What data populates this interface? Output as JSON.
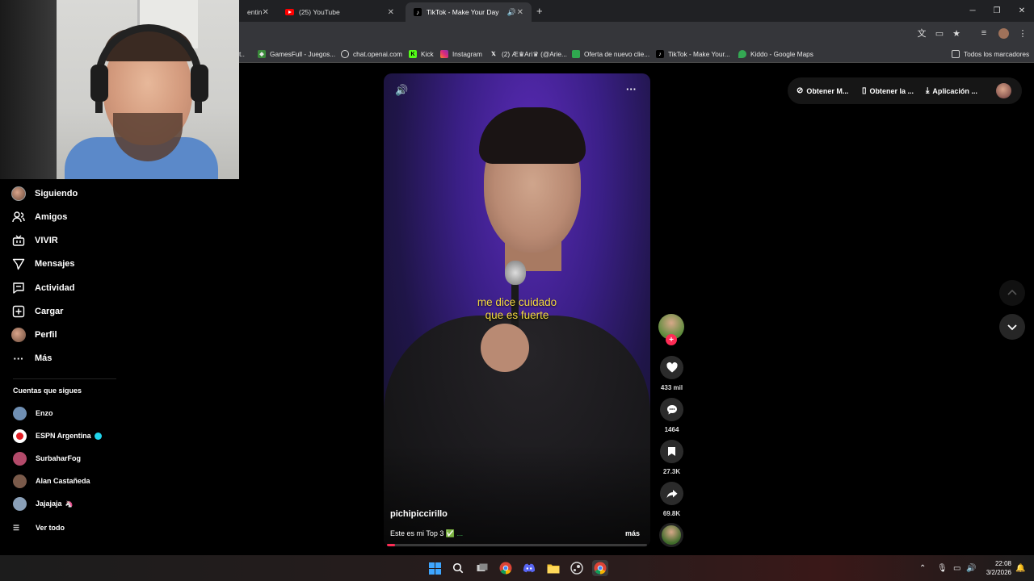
{
  "browser": {
    "tabs": [
      {
        "label": "entin",
        "active": false
      },
      {
        "label": "(25) YouTube",
        "active": false
      },
      {
        "label": "TikTok - Make Your Day",
        "active": true
      }
    ],
    "new_tab": "+",
    "window_controls": {
      "minimize": "─",
      "restore": "❐",
      "close": "✕"
    }
  },
  "bookmarks": {
    "items": [
      {
        "label": "GamesFull - Juegos...",
        "icon": "gamepad-icon"
      },
      {
        "label": "chat.openai.com",
        "icon": "openai-icon"
      },
      {
        "label": "Kick",
        "icon": "kick-icon"
      },
      {
        "label": "Instagram",
        "icon": "instagram-icon"
      },
      {
        "label": "(2) Æ♛Ari♛ (@Arie...",
        "icon": "x-icon"
      },
      {
        "label": "Oferta de nuevo clie...",
        "icon": "store-icon"
      },
      {
        "label": "TikTok - Make Your...",
        "icon": "tiktok-icon"
      },
      {
        "label": "Kiddo - Google Maps",
        "icon": "maps-icon"
      }
    ],
    "all_bookmarks": "Todos los marcadores"
  },
  "sidebar": {
    "items": [
      {
        "label": "Siguiendo",
        "icon": "following-avatar-icon"
      },
      {
        "label": "Amigos",
        "icon": "friends-icon"
      },
      {
        "label": "VIVIR",
        "icon": "live-icon"
      },
      {
        "label": "Mensajes",
        "icon": "messages-icon"
      },
      {
        "label": "Actividad",
        "icon": "activity-icon"
      },
      {
        "label": "Cargar",
        "icon": "upload-icon"
      },
      {
        "label": "Perfil",
        "icon": "profile-avatar-icon"
      },
      {
        "label": "Más",
        "icon": "more-icon"
      }
    ],
    "following_header": "Cuentas que sigues",
    "following": [
      {
        "name": "Enzo",
        "color": "#6f8fb3"
      },
      {
        "name": "ESPN Argentina",
        "color": "#ffffff",
        "verified": true
      },
      {
        "name": "SurbaharFog",
        "color": "#b34a6a"
      },
      {
        "name": "Alan Castañeda",
        "color": "#7a5a4a"
      },
      {
        "name": "Jajajaja",
        "color": "#8aa0b8",
        "emoji": "🦄"
      }
    ],
    "see_all": "Ver todo"
  },
  "video": {
    "caption_line1": "me dice cuidado",
    "caption_line2": "que es fuerte",
    "username": "pichipiccirillo",
    "description": "Este es mi Top 3",
    "description_suffix": "✅ ...",
    "more": "más",
    "progress": 0.03
  },
  "actions": {
    "likes": "433 mil",
    "comments": "1464",
    "saves": "27.3K",
    "shares": "69.8K"
  },
  "topbar": {
    "get_coins": "Obtener M...",
    "get_app": "Obtener la ...",
    "desktop_app": "Aplicación ..."
  },
  "clock": {
    "time": "22:08",
    "date": "3/2/2026"
  },
  "colors": {
    "accent": "#fe2c55",
    "caption": "#f4d940",
    "verified": "#20d5ec"
  }
}
